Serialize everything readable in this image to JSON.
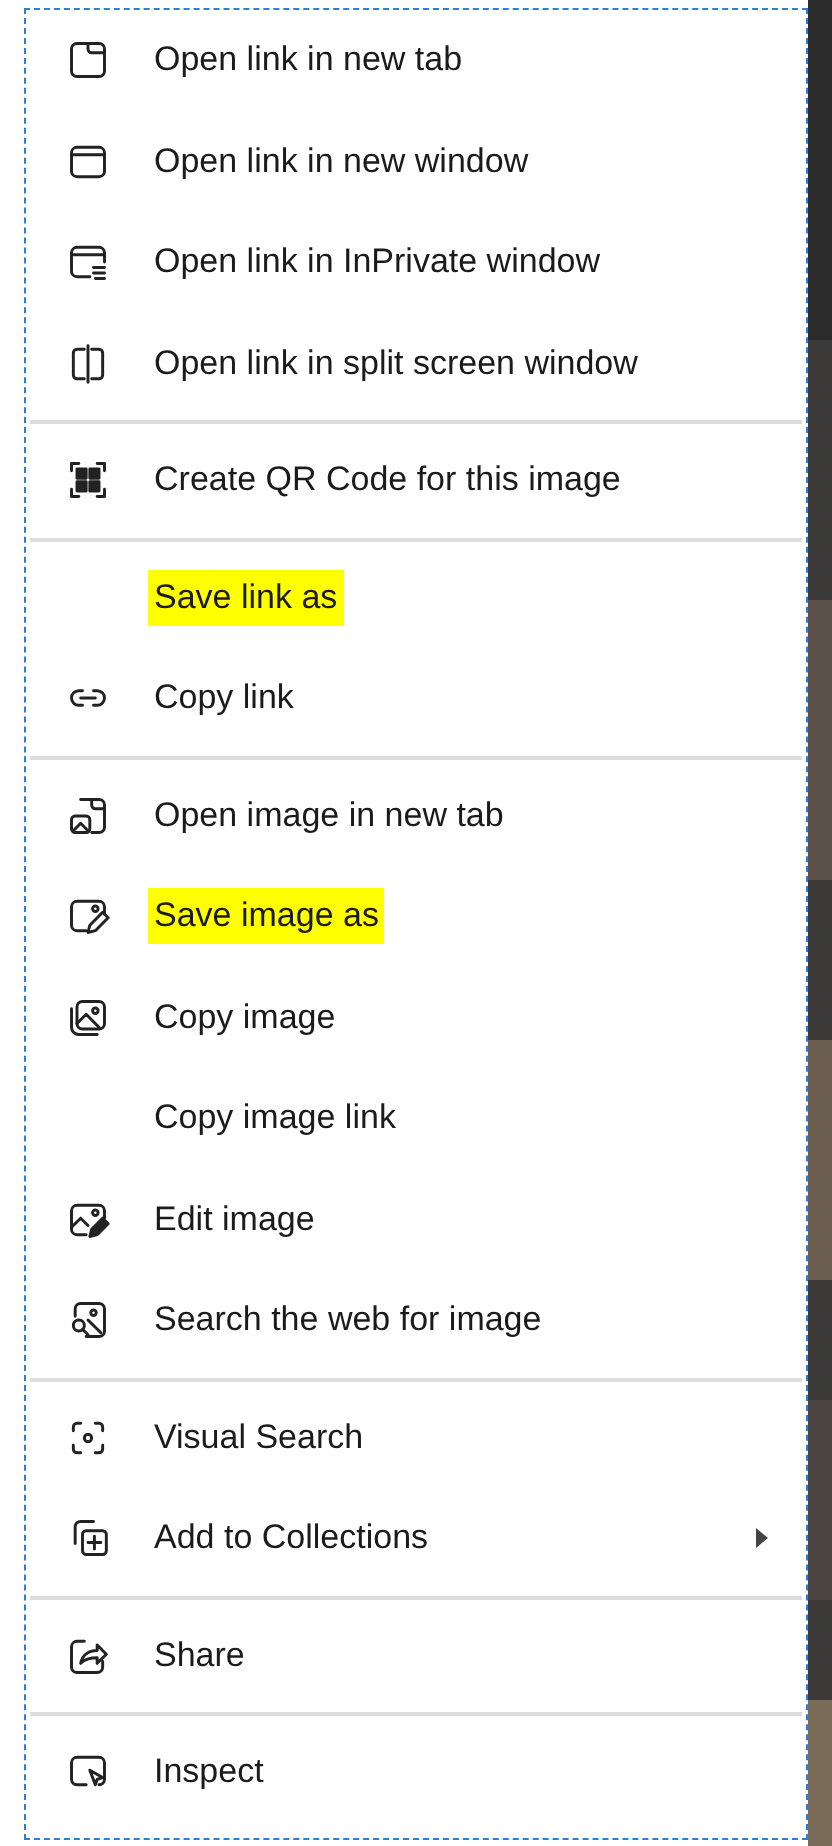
{
  "menu": {
    "groups": [
      {
        "items": [
          {
            "label": "Open link in new tab"
          },
          {
            "label": "Open link in new window"
          },
          {
            "label": "Open link in InPrivate window"
          },
          {
            "label": "Open link in split screen window"
          }
        ]
      },
      {
        "items": [
          {
            "label": "Create QR Code for this image"
          }
        ]
      },
      {
        "items": [
          {
            "label": "Save link as",
            "highlighted": true
          },
          {
            "label": "Copy link"
          }
        ]
      },
      {
        "items": [
          {
            "label": "Open image in new tab"
          },
          {
            "label": "Save image as",
            "highlighted": true
          },
          {
            "label": "Copy image"
          },
          {
            "label": "Copy image link"
          },
          {
            "label": "Edit image"
          },
          {
            "label": "Search the web for image"
          }
        ]
      },
      {
        "items": [
          {
            "label": "Visual Search"
          },
          {
            "label": "Add to Collections",
            "submenu": true
          }
        ]
      },
      {
        "items": [
          {
            "label": "Share"
          }
        ]
      },
      {
        "items": [
          {
            "label": "Inspect"
          }
        ]
      }
    ]
  }
}
